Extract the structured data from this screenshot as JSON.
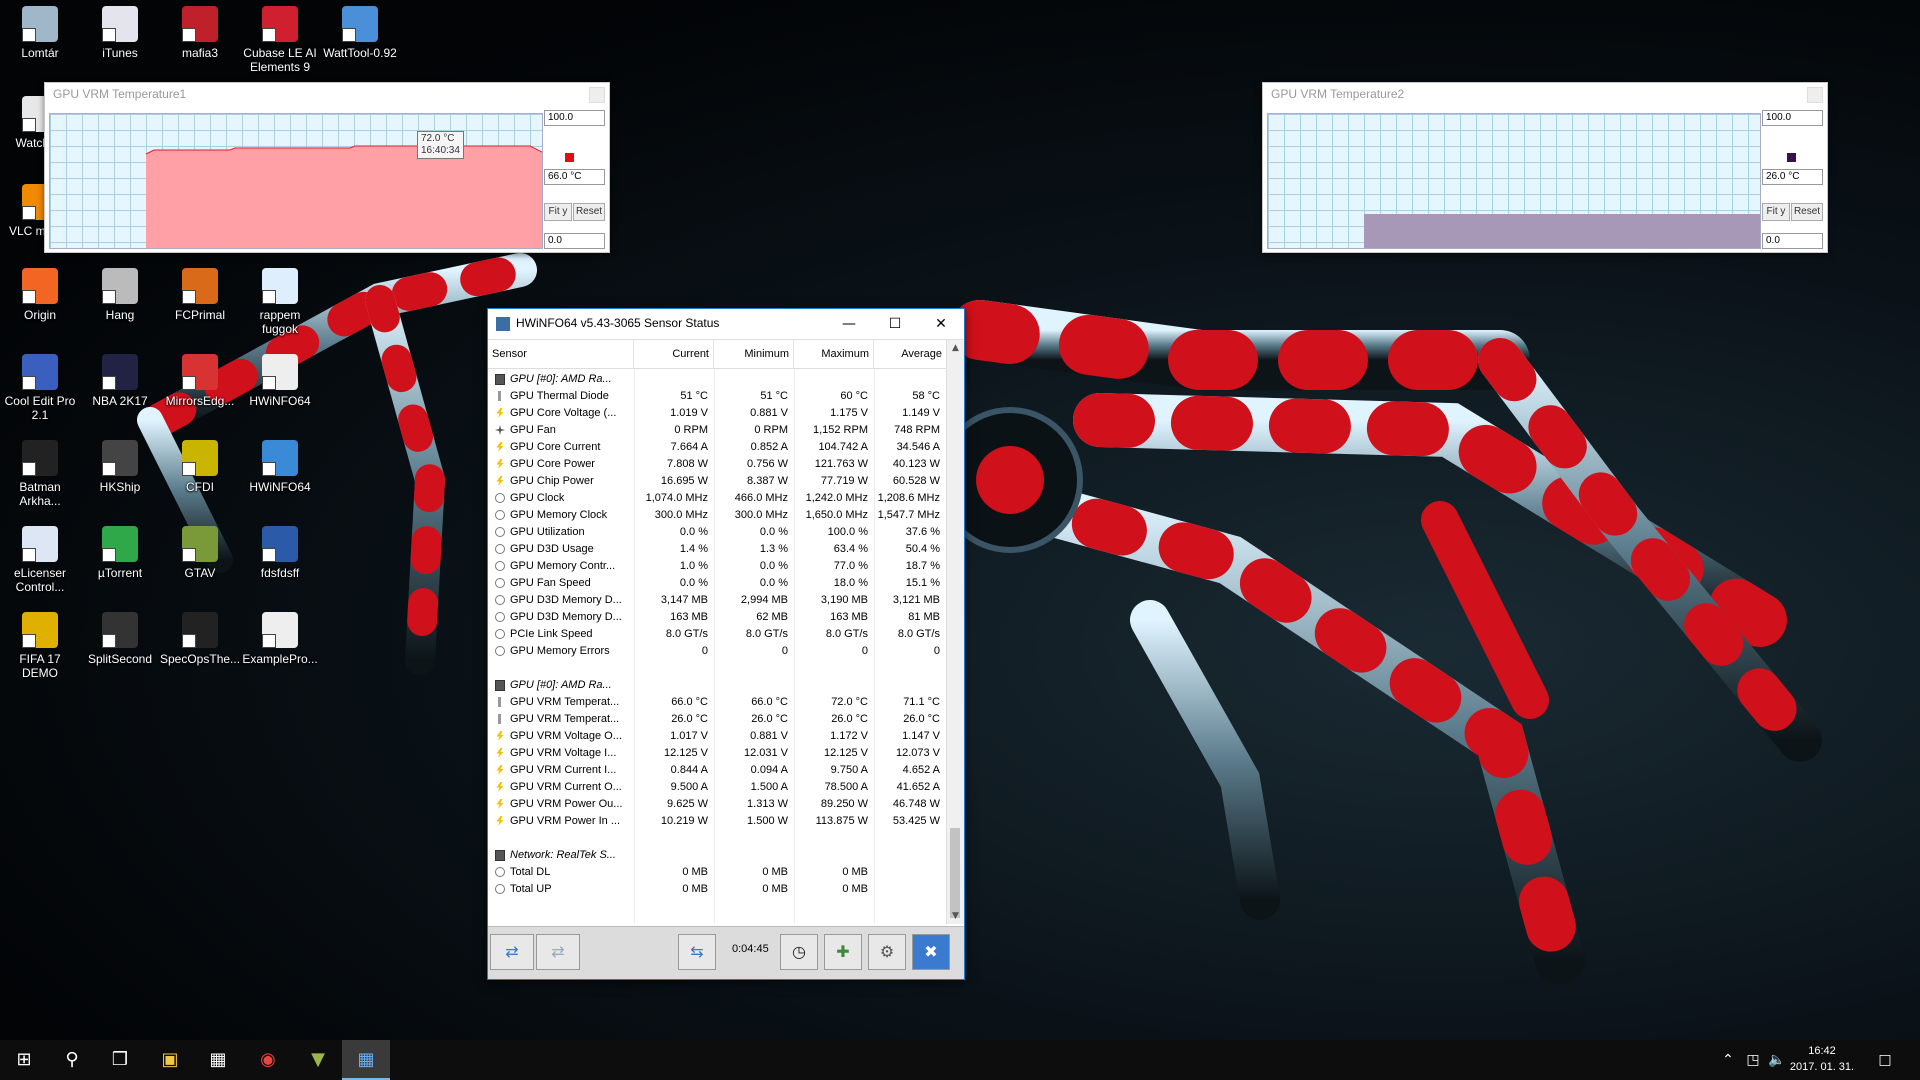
{
  "desktop": {
    "icons": [
      {
        "label": "Lomtár",
        "color": "#9fb7c9"
      },
      {
        "label": "iTunes",
        "color": "#e4e4ef"
      },
      {
        "label": "mafia3",
        "color": "#c0202a"
      },
      {
        "label": "Cubase LE AI Elements 9",
        "color": "#d02030"
      },
      {
        "label": "WattTool-0.92",
        "color": "#4a8fd8"
      },
      {
        "label": "Watch_D",
        "color": "#e8e8e8"
      },
      {
        "label": "VLC m play",
        "color": "#f08a00"
      },
      {
        "label": "Origin",
        "color": "#f26522"
      },
      {
        "label": "Hang",
        "color": "#bbbbbb"
      },
      {
        "label": "FCPrimal",
        "color": "#d86a1a"
      },
      {
        "label": "rappem fuggok",
        "color": "#dfeefc"
      },
      {
        "label": "Cool Edit Pro 2.1",
        "color": "#3b5fbf"
      },
      {
        "label": "NBA 2K17",
        "color": "#222244"
      },
      {
        "label": "MirrorsEdg...",
        "color": "#d83232"
      },
      {
        "label": "HWiNFO64",
        "color": "#eeeeee"
      },
      {
        "label": "Batman Arkha...",
        "color": "#222222"
      },
      {
        "label": "HKShip",
        "color": "#444444"
      },
      {
        "label": "CFDI",
        "color": "#c9b400"
      },
      {
        "label": "HWiNFO64",
        "color": "#3a8ad8"
      },
      {
        "label": "eLicenser Control...",
        "color": "#dde6f5"
      },
      {
        "label": "µTorrent",
        "color": "#2fa84a"
      },
      {
        "label": "GTAV",
        "color": "#7a9a3a"
      },
      {
        "label": "fdsfdsff",
        "color": "#2a5aa8"
      },
      {
        "label": "FIFA 17 DEMO",
        "color": "#e0b000"
      },
      {
        "label": "SplitSecond",
        "color": "#333333"
      },
      {
        "label": "SpecOpsThe...",
        "color": "#222222"
      },
      {
        "label": "ExamplePro...",
        "color": "#eeeeee"
      }
    ]
  },
  "graph1": {
    "title": "GPU VRM Temperature1",
    "max_field": "100.0",
    "current_field": "66.0 °C",
    "min_field": "0.0",
    "fit_label": "Fit y",
    "reset_label": "Reset",
    "tooltip_line1": "72.0 °C",
    "tooltip_line2": "16:40:34",
    "fill_color": "#ffa0a6",
    "line_color": "#e0202a",
    "swatch_color": "#e01010"
  },
  "graph2": {
    "title": "GPU VRM Temperature2",
    "max_field": "100.0",
    "current_field": "26.0 °C",
    "min_field": "0.0",
    "fit_label": "Fit y",
    "reset_label": "Reset",
    "fill_color": "#a898b8",
    "swatch_color": "#3a1050"
  },
  "hwinfo": {
    "title": "HWiNFO64 v5.43-3065 Sensor Status",
    "columns": [
      "Sensor",
      "Current",
      "Minimum",
      "Maximum",
      "Average"
    ],
    "rows": [
      {
        "type": "group",
        "name": "GPU [#0]: AMD Ra..."
      },
      {
        "icon": "therm",
        "name": "GPU Thermal Diode",
        "cur": "51 °C",
        "min": "51 °C",
        "max": "60 °C",
        "avg": "58 °C"
      },
      {
        "icon": "bolt",
        "name": "GPU Core Voltage (...",
        "cur": "1.019 V",
        "min": "0.881 V",
        "max": "1.175 V",
        "avg": "1.149 V"
      },
      {
        "icon": "fan",
        "name": "GPU Fan",
        "cur": "0 RPM",
        "min": "0 RPM",
        "max": "1,152 RPM",
        "avg": "748 RPM"
      },
      {
        "icon": "bolt",
        "name": "GPU Core Current",
        "cur": "7.664 A",
        "min": "0.852 A",
        "max": "104.742 A",
        "avg": "34.546 A"
      },
      {
        "icon": "bolt",
        "name": "GPU Core Power",
        "cur": "7.808 W",
        "min": "0.756 W",
        "max": "121.763 W",
        "avg": "40.123 W"
      },
      {
        "icon": "bolt",
        "name": "GPU Chip Power",
        "cur": "16.695 W",
        "min": "8.387 W",
        "max": "77.719 W",
        "avg": "60.528 W"
      },
      {
        "icon": "clock",
        "name": "GPU Clock",
        "cur": "1,074.0 MHz",
        "min": "466.0 MHz",
        "max": "1,242.0 MHz",
        "avg": "1,208.6 MHz"
      },
      {
        "icon": "clock",
        "name": "GPU Memory Clock",
        "cur": "300.0 MHz",
        "min": "300.0 MHz",
        "max": "1,650.0 MHz",
        "avg": "1,547.7 MHz"
      },
      {
        "icon": "clock",
        "name": "GPU Utilization",
        "cur": "0.0 %",
        "min": "0.0 %",
        "max": "100.0 %",
        "avg": "37.6 %"
      },
      {
        "icon": "clock",
        "name": "GPU D3D Usage",
        "cur": "1.4 %",
        "min": "1.3 %",
        "max": "63.4 %",
        "avg": "50.4 %"
      },
      {
        "icon": "clock",
        "name": "GPU Memory Contr...",
        "cur": "1.0 %",
        "min": "0.0 %",
        "max": "77.0 %",
        "avg": "18.7 %"
      },
      {
        "icon": "clock",
        "name": "GPU Fan Speed",
        "cur": "0.0 %",
        "min": "0.0 %",
        "max": "18.0 %",
        "avg": "15.1 %"
      },
      {
        "icon": "clock",
        "name": "GPU D3D Memory D...",
        "cur": "3,147 MB",
        "min": "2,994 MB",
        "max": "3,190 MB",
        "avg": "3,121 MB"
      },
      {
        "icon": "clock",
        "name": "GPU D3D Memory D...",
        "cur": "163 MB",
        "min": "62 MB",
        "max": "163 MB",
        "avg": "81 MB"
      },
      {
        "icon": "clock",
        "name": "PCIe Link Speed",
        "cur": "8.0 GT/s",
        "min": "8.0 GT/s",
        "max": "8.0 GT/s",
        "avg": "8.0 GT/s"
      },
      {
        "icon": "clock",
        "name": "GPU Memory Errors",
        "cur": "0",
        "min": "0",
        "max": "0",
        "avg": "0"
      },
      {
        "type": "blank"
      },
      {
        "type": "group",
        "name": "GPU [#0]: AMD Ra..."
      },
      {
        "icon": "therm",
        "name": "GPU VRM Temperat...",
        "cur": "66.0 °C",
        "min": "66.0 °C",
        "max": "72.0 °C",
        "avg": "71.1 °C"
      },
      {
        "icon": "therm",
        "name": "GPU VRM Temperat...",
        "cur": "26.0 °C",
        "min": "26.0 °C",
        "max": "26.0 °C",
        "avg": "26.0 °C"
      },
      {
        "icon": "bolt",
        "name": "GPU VRM Voltage O...",
        "cur": "1.017 V",
        "min": "0.881 V",
        "max": "1.172 V",
        "avg": "1.147 V"
      },
      {
        "icon": "bolt",
        "name": "GPU VRM Voltage I...",
        "cur": "12.125 V",
        "min": "12.031 V",
        "max": "12.125 V",
        "avg": "12.073 V"
      },
      {
        "icon": "bolt",
        "name": "GPU VRM Current I...",
        "cur": "0.844 A",
        "min": "0.094 A",
        "max": "9.750 A",
        "avg": "4.652 A"
      },
      {
        "icon": "bolt",
        "name": "GPU VRM Current O...",
        "cur": "9.500 A",
        "min": "1.500 A",
        "max": "78.500 A",
        "avg": "41.652 A"
      },
      {
        "icon": "bolt",
        "name": "GPU VRM Power Ou...",
        "cur": "9.625 W",
        "min": "1.313 W",
        "max": "89.250 W",
        "avg": "46.748 W"
      },
      {
        "icon": "bolt",
        "name": "GPU VRM Power In ...",
        "cur": "10.219 W",
        "min": "1.500 W",
        "max": "113.875 W",
        "avg": "53.425 W"
      },
      {
        "type": "blank"
      },
      {
        "type": "group",
        "name": "Network: RealTek S..."
      },
      {
        "icon": "clock",
        "name": "Total DL",
        "cur": "0 MB",
        "min": "0 MB",
        "max": "0 MB",
        "avg": ""
      },
      {
        "icon": "clock",
        "name": "Total UP",
        "cur": "0 MB",
        "min": "0 MB",
        "max": "0 MB",
        "avg": ""
      }
    ],
    "footer_time": "0:04:45"
  },
  "taskbar": {
    "time": "16:42",
    "date": "2017. 01. 31."
  }
}
